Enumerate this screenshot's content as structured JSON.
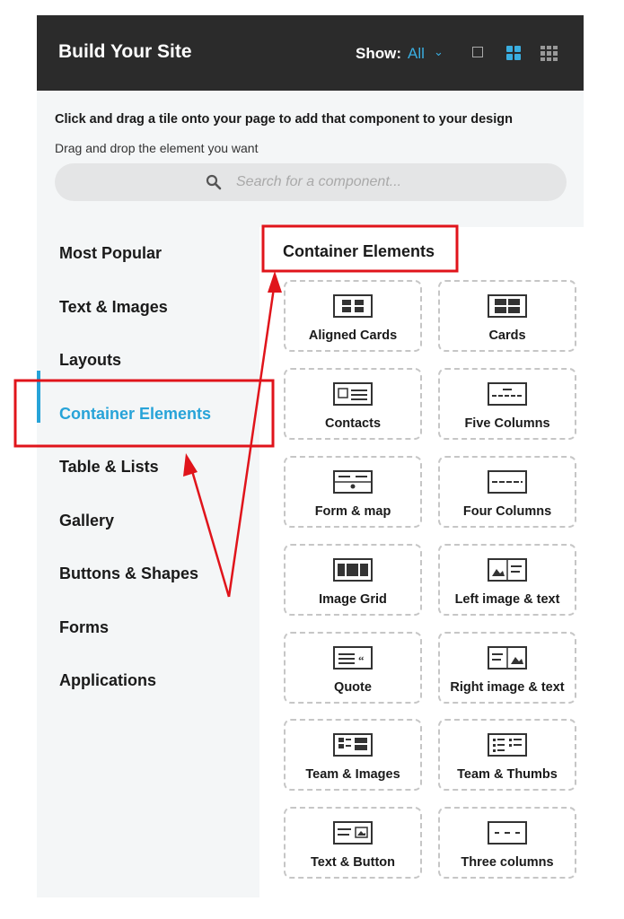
{
  "header": {
    "title": "Build Your Site",
    "show_label": "Show:",
    "show_value": "All"
  },
  "instructions": {
    "line1": "Click and drag a tile onto your page to add that component to your design",
    "line2": "Drag and drop the element you want"
  },
  "search": {
    "placeholder": "Search for a component..."
  },
  "sidebar": {
    "items": [
      {
        "label": "Most Popular"
      },
      {
        "label": "Text & Images"
      },
      {
        "label": "Layouts"
      },
      {
        "label": "Container Elements",
        "active": true
      },
      {
        "label": "Table & Lists"
      },
      {
        "label": "Gallery"
      },
      {
        "label": "Buttons & Shapes"
      },
      {
        "label": "Forms"
      },
      {
        "label": "Applications"
      }
    ]
  },
  "content": {
    "section_title": "Container Elements",
    "tiles": [
      {
        "label": "Aligned Cards",
        "icon": "aligned-cards-icon"
      },
      {
        "label": "Cards",
        "icon": "cards-icon"
      },
      {
        "label": "Contacts",
        "icon": "contacts-icon"
      },
      {
        "label": "Five Columns",
        "icon": "five-columns-icon"
      },
      {
        "label": "Form & map",
        "icon": "form-map-icon"
      },
      {
        "label": "Four Columns",
        "icon": "four-columns-icon"
      },
      {
        "label": "Image Grid",
        "icon": "image-grid-icon"
      },
      {
        "label": "Left image & text",
        "icon": "left-image-text-icon"
      },
      {
        "label": "Quote",
        "icon": "quote-icon"
      },
      {
        "label": "Right image & text",
        "icon": "right-image-text-icon"
      },
      {
        "label": "Team & Images",
        "icon": "team-images-icon"
      },
      {
        "label": "Team & Thumbs",
        "icon": "team-thumbs-icon"
      },
      {
        "label": "Text & Button",
        "icon": "text-button-icon"
      },
      {
        "label": "Three columns",
        "icon": "three-columns-icon"
      }
    ]
  },
  "colors": {
    "accent": "#27a3d8",
    "header_bg": "#2b2b2b",
    "annotation": "#e0141b"
  }
}
